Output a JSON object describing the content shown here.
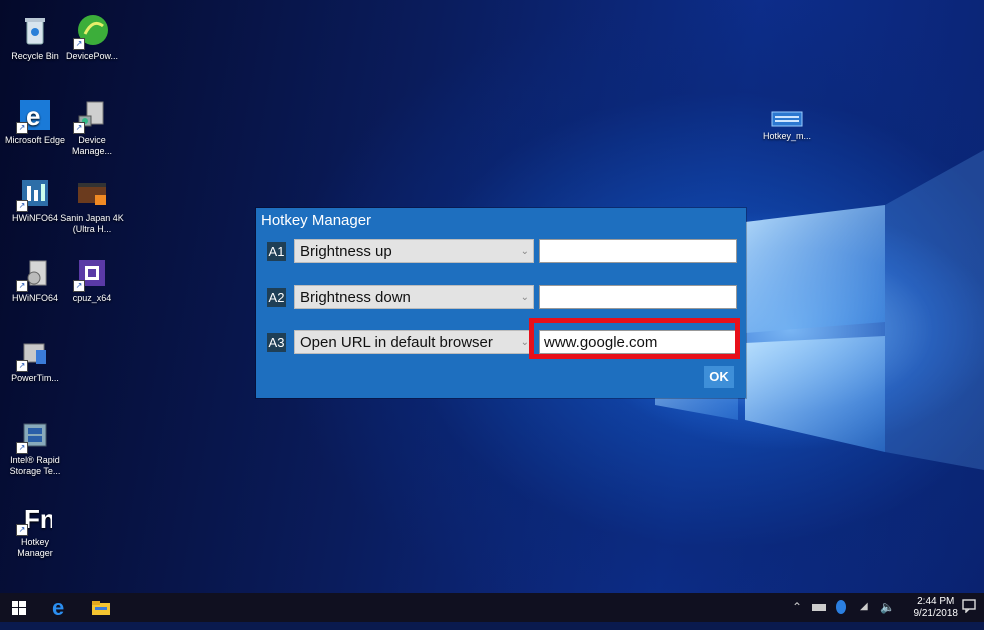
{
  "desktop": {
    "icons": [
      {
        "label": "Recycle Bin"
      },
      {
        "label": "DevicePow..."
      },
      {
        "label": "Microsoft Edge"
      },
      {
        "label": "Device Manage..."
      },
      {
        "label": "HWiNFO64"
      },
      {
        "label": "Sanin Japan 4K (Ultra H..."
      },
      {
        "label": "HWiNFO64"
      },
      {
        "label": "cpuz_x64"
      },
      {
        "label": "PowerTim..."
      },
      {
        "label": "Intel® Rapid Storage Te..."
      },
      {
        "label": "Hotkey Manager"
      },
      {
        "label": "Hotkey_m..."
      }
    ]
  },
  "dialog": {
    "title": "Hotkey Manager",
    "rows": [
      {
        "badge": "A1",
        "action": "Brightness up",
        "value": ""
      },
      {
        "badge": "A2",
        "action": "Brightness down",
        "value": ""
      },
      {
        "badge": "A3",
        "action": "Open URL in default browser",
        "value": "www.google.com"
      }
    ],
    "ok_label": "OK"
  },
  "taskbar": {
    "time": "2:44 PM",
    "date": "9/21/2018"
  },
  "colors": {
    "dialog_bg": "#1e6fbf",
    "highlight": "#e8101a",
    "badge_bg": "#1f3f56"
  }
}
